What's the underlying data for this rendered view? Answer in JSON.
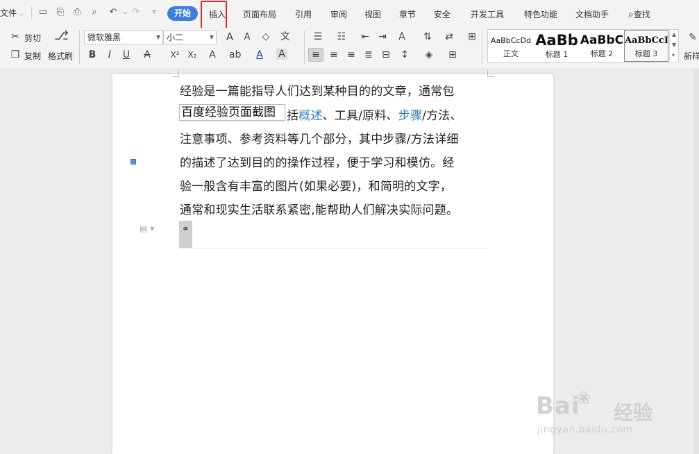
{
  "menubar": {
    "file_label": "文件",
    "tabs": [
      "开始",
      "插入",
      "页面布局",
      "引用",
      "审阅",
      "视图",
      "章节",
      "安全",
      "开发工具",
      "特色功能",
      "文档助手"
    ],
    "active_tab": "开始",
    "highlighted_tab": "插入",
    "search_label": "查找"
  },
  "ribbon": {
    "cut_label": "剪切",
    "copy_label": "复制",
    "format_painter_label": "格式刷",
    "font_name": "微软雅黑",
    "font_size": "小二",
    "styles": [
      {
        "sample": "AaBbCcDd",
        "name": "正文"
      },
      {
        "sample": "AaBb",
        "name": "标题 1"
      },
      {
        "sample": "AaBbC",
        "name": "标题 2"
      },
      {
        "sample": "AaBbCcI",
        "name": "标题 3"
      }
    ],
    "new_style_label": "新样"
  },
  "document": {
    "lines": [
      "经验是一篇能指导人们达到某种目的的文章，通常包",
      "括概述、工具/原料、步骤/方法、",
      "注意事项、参考资料等几个部分，其中步骤/方法详细",
      "的描述了达到目的的操作过程，便于学习和模仿。经",
      "验一般含有丰富的图片(如果必要)，和简明的文字，",
      "通常和现实生活联系紧密,能帮助人们解决实际问题。"
    ],
    "line2_parts": {
      "a": "括",
      "b": "概述",
      "c": "、工具/原料、",
      "d": "步骤",
      "e": "/方法、"
    },
    "tooltip": "百度经验页面截图"
  },
  "watermark": {
    "logo": "Bai",
    "brand_cn": "经验",
    "url": "jingyan.baidu.com"
  },
  "colors": {
    "accent": "#3b7fe0",
    "highlight": "#e8212a",
    "link": "#2f7bc0"
  }
}
